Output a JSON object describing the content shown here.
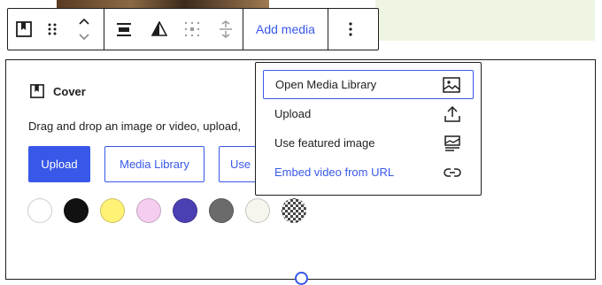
{
  "toolbar": {
    "block_icon": "cover-block-icon",
    "drag_icon": "drag-handle-icon",
    "move_icon": "move-up-down-icon",
    "align_icon": "align-icon",
    "duotone_icon": "duotone-icon",
    "position_icon": "content-position-icon",
    "full_height_icon": "full-height-icon",
    "add_media_label": "Add media",
    "options_icon": "more-options-icon"
  },
  "cover": {
    "title": "Cover",
    "instructions": "Drag and drop an image or video, upload,",
    "upload_label": "Upload",
    "media_library_label": "Media Library",
    "third_button_label": "Use",
    "swatches": [
      {
        "name": "white",
        "color": "#ffffff"
      },
      {
        "name": "black",
        "color": "#111111"
      },
      {
        "name": "yellow",
        "color": "#fff275"
      },
      {
        "name": "pink",
        "color": "#f5cdf0"
      },
      {
        "name": "purple",
        "color": "#4b3fb4"
      },
      {
        "name": "gray",
        "color": "#6b6b6b"
      },
      {
        "name": "off-white",
        "color": "#f6f6ef"
      },
      {
        "name": "transparent",
        "color": "transparent"
      }
    ]
  },
  "menu": {
    "items": [
      {
        "label": "Open Media Library",
        "icon": "image-icon"
      },
      {
        "label": "Upload",
        "icon": "upload-icon"
      },
      {
        "label": "Use featured image",
        "icon": "featured-image-icon"
      },
      {
        "label": "Embed video from URL",
        "icon": "link-icon"
      }
    ]
  },
  "colors": {
    "accent": "#3858e9",
    "text": "#1e1e1e",
    "border": "#1e1e1e"
  }
}
